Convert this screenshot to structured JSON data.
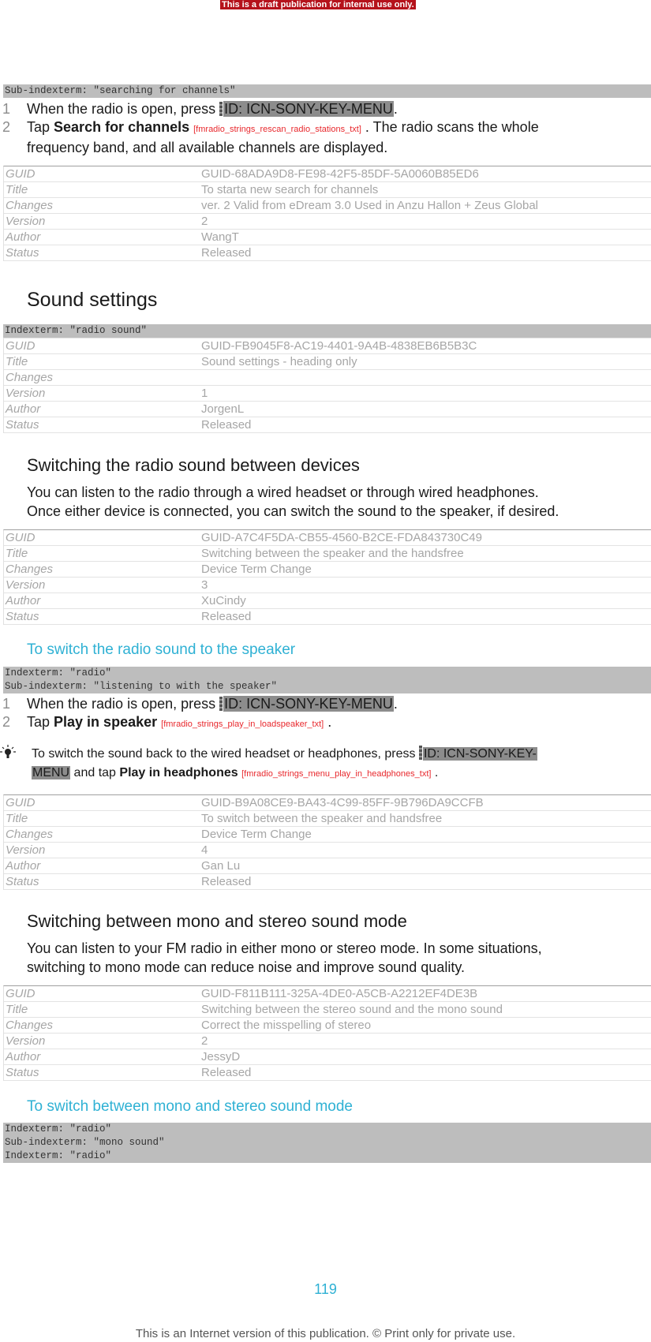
{
  "banner": "This is a draft publication for internal use only.",
  "section1": {
    "index_lines": [
      "Sub-indexterm: \"searching for channels\""
    ],
    "steps": [
      {
        "num": "1",
        "pre": "When the radio is open, press ",
        "key": "ID: ICN-SONY-KEY-MENU",
        "post": "."
      },
      {
        "num": "2",
        "pre": "Tap ",
        "ui": "Search for channels",
        "ref": "[fmradio_strings_rescan_radio_stations_txt]",
        "post": " . The radio scans the whole",
        "cont": "frequency band, and all available channels are displayed."
      }
    ],
    "meta": [
      {
        "k": "GUID",
        "v": "GUID-68ADA9D8-FE98-42F5-85DF-5A0060B85ED6"
      },
      {
        "k": "Title",
        "v": "To starta new search for channels"
      },
      {
        "k": "Changes",
        "v": "ver. 2 Valid from eDream 3.0 Used in Anzu Hallon + Zeus Global"
      },
      {
        "k": "Version",
        "v": "2"
      },
      {
        "k": "Author",
        "v": "WangT"
      },
      {
        "k": "Status",
        "v": "Released"
      }
    ]
  },
  "section2": {
    "heading": "Sound settings",
    "index_lines": [
      "Indexterm: \"radio sound\""
    ],
    "meta": [
      {
        "k": "GUID",
        "v": "GUID-FB9045F8-AC19-4401-9A4B-4838EB6B5B3C"
      },
      {
        "k": "Title",
        "v": "Sound settings - heading only"
      },
      {
        "k": "Changes",
        "v": ""
      },
      {
        "k": "Version",
        "v": "1"
      },
      {
        "k": "Author",
        "v": "JorgenL"
      },
      {
        "k": "Status",
        "v": "Released"
      }
    ]
  },
  "section3": {
    "heading": "Switching the radio sound between devices",
    "body": [
      "You can listen to the radio through a wired headset or through wired headphones.",
      "Once either device is connected, you can switch the sound to the speaker, if desired."
    ],
    "meta": [
      {
        "k": "GUID",
        "v": "GUID-A7C4F5DA-CB55-4560-B2CE-FDA843730C49"
      },
      {
        "k": "Title",
        "v": "Switching between the speaker and the handsfree"
      },
      {
        "k": "Changes",
        "v": "Device Term Change"
      },
      {
        "k": "Version",
        "v": "3"
      },
      {
        "k": "Author",
        "v": "XuCindy"
      },
      {
        "k": "Status",
        "v": "Released"
      }
    ]
  },
  "section4": {
    "heading": "To switch the radio sound to the speaker",
    "index_lines": [
      "Indexterm: \"radio\"",
      "Sub-indexterm: \"listening to with the speaker\""
    ],
    "steps": [
      {
        "num": "1",
        "pre": "When the radio is open, press ",
        "key": "ID: ICN-SONY-KEY-MENU",
        "post": "."
      },
      {
        "num": "2",
        "pre": "Tap ",
        "ui": "Play in speaker",
        "ref": "[fmradio_strings_play_in_loadspeaker_txt]",
        "post": " ."
      }
    ],
    "tip": {
      "icon": "lightbulb-icon",
      "pre": "To switch the sound back to the wired headset or headphones, press ",
      "key1": "ID: ICN-SONY-KEY-",
      "key2": "MENU",
      "mid": " and tap ",
      "ui": "Play in headphones",
      "ref": "[fmradio_strings_menu_play_in_headphones_txt]",
      "post": " ."
    },
    "meta": [
      {
        "k": "GUID",
        "v": "GUID-B9A08CE9-BA43-4C99-85FF-9B796DA9CCFB"
      },
      {
        "k": "Title",
        "v": "To switch between the speaker and handsfree"
      },
      {
        "k": "Changes",
        "v": "Device Term Change"
      },
      {
        "k": "Version",
        "v": "4"
      },
      {
        "k": "Author",
        "v": "Gan Lu"
      },
      {
        "k": "Status",
        "v": "Released"
      }
    ]
  },
  "section5": {
    "heading": "Switching between mono and stereo sound mode",
    "body": [
      "You can listen to your FM radio in either mono or stereo mode. In some situations,",
      "switching to mono mode can reduce noise and improve sound quality."
    ],
    "meta": [
      {
        "k": "GUID",
        "v": "GUID-F811B111-325A-4DE0-A5CB-A2212EF4DE3B"
      },
      {
        "k": "Title",
        "v": "Switching between the stereo sound and the mono sound"
      },
      {
        "k": "Changes",
        "v": "Correct the misspelling of stereo"
      },
      {
        "k": "Version",
        "v": "2"
      },
      {
        "k": "Author",
        "v": "JessyD"
      },
      {
        "k": "Status",
        "v": "Released"
      }
    ]
  },
  "section6": {
    "heading": "To switch between mono and stereo sound mode",
    "index_lines": [
      "Indexterm: \"radio\"",
      "Sub-indexterm: \"mono sound\"",
      "Indexterm: \"radio\""
    ]
  },
  "page_number": "119",
  "footer": "This is an Internet version of this publication. © Print only for private use."
}
